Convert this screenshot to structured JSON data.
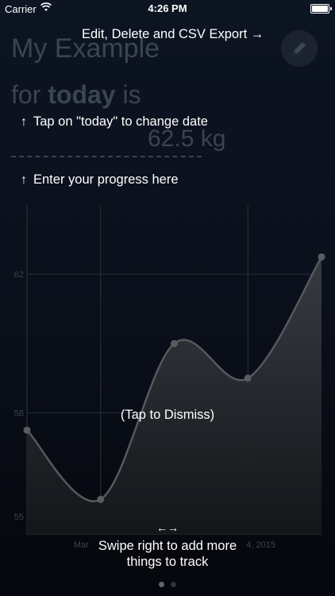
{
  "status_bar": {
    "carrier": "Carrier",
    "time": "4:26 PM"
  },
  "header": {
    "title": "My Example",
    "date_prefix": "for",
    "date_link": "today",
    "date_suffix": "is",
    "value": "62.5 kg"
  },
  "overlay": {
    "edit_hint": "Edit, Delete and CSV Export →",
    "date_hint": "Tap on \"today\" to change date",
    "progress_hint": "Enter your progress here",
    "dismiss_hint": "(Tap to Dismiss)",
    "swipe_hint_line1": "Swipe right to add more",
    "swipe_hint_line2": "things to track",
    "swipe_arrow": "←→",
    "up_arrow": "↑"
  },
  "chart_data": {
    "type": "line",
    "y_ticks": [
      62,
      58,
      55
    ],
    "x_tick_labels": [
      "Mar",
      "4, 2015"
    ],
    "values": [
      57.5,
      55.5,
      60.0,
      59.0,
      62.5
    ],
    "x_positions": [
      0,
      1,
      2,
      3,
      4
    ],
    "ylim": [
      54.5,
      64.0
    ],
    "grid": true
  },
  "pager": {
    "pages": 2,
    "active": 0
  },
  "colors": {
    "accent": "#ffffff",
    "dim_text": "#3b4453",
    "grid": "#2a2f38"
  },
  "icons": {
    "edit": "pencil-icon",
    "wifi": "wifi-icon",
    "battery": "battery-icon"
  }
}
